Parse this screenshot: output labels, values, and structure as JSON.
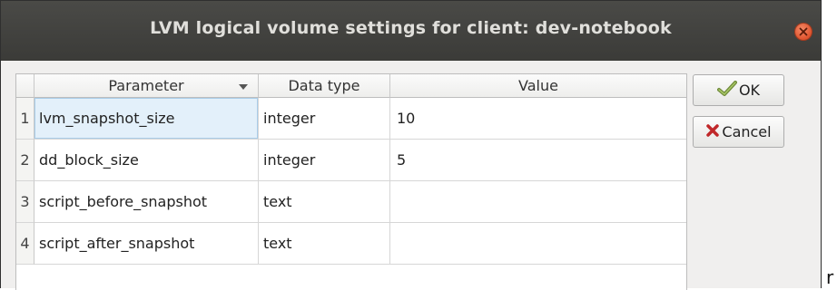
{
  "window": {
    "title": "LVM logical volume settings for client: dev-notebook"
  },
  "table": {
    "headers": {
      "parameter": "Parameter",
      "data_type": "Data type",
      "value": "Value"
    },
    "rows": [
      {
        "num": "1",
        "parameter": "lvm_snapshot_size",
        "data_type": "integer",
        "value": "10"
      },
      {
        "num": "2",
        "parameter": "dd_block_size",
        "data_type": "integer",
        "value": "5"
      },
      {
        "num": "3",
        "parameter": "script_before_snapshot",
        "data_type": "text",
        "value": ""
      },
      {
        "num": "4",
        "parameter": "script_after_snapshot",
        "data_type": "text",
        "value": ""
      }
    ]
  },
  "buttons": {
    "ok": "OK",
    "cancel": "Cancel"
  },
  "background_fragment": "r",
  "icons": {
    "close": "close-icon",
    "ok": "ok-checkmark-icon",
    "cancel": "cancel-x-icon"
  },
  "colors": {
    "titlebar": "#3f3f3c",
    "close": "#e8603c",
    "selection": "#e3f0fa"
  }
}
